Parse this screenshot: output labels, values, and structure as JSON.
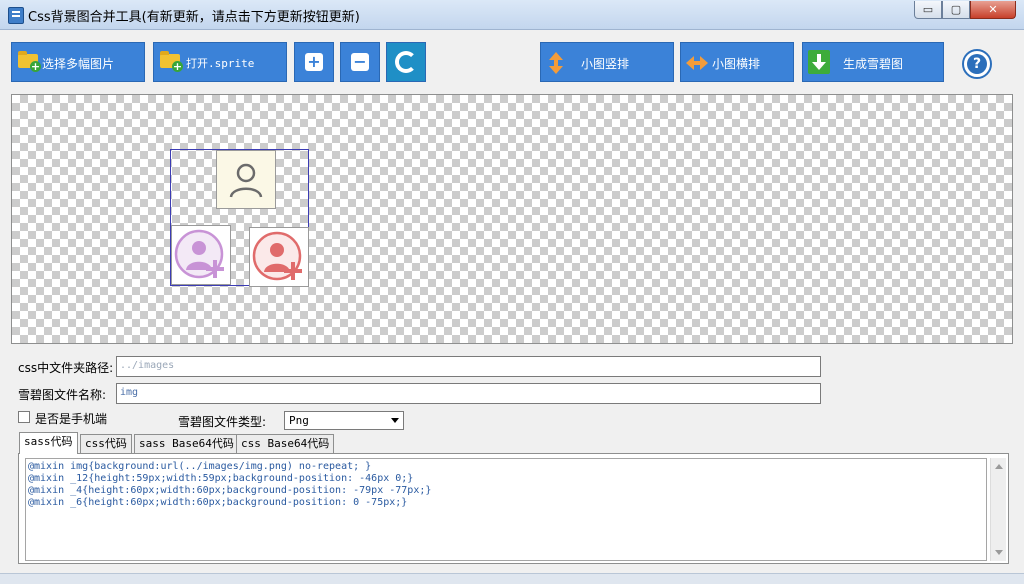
{
  "window": {
    "title": "Css背景图合并工具(有新更新，请点击下方更新按钮更新)",
    "controls": {
      "minimize": "▭",
      "maximize": "▢",
      "close": "✕"
    }
  },
  "toolbar": {
    "select_images": "选择多幅图片",
    "open_sprite": "打开.sprite",
    "add_icon": "+",
    "remove_icon": "−",
    "vertical": "小图竖排",
    "horizontal": "小图横排",
    "generate": "生成雪碧图",
    "help": "?",
    "accent": "#3b82d8"
  },
  "form": {
    "css_path_label": "css中文件夹路径:",
    "css_path_value": "../images",
    "sprite_name_label": "雪碧图文件名称:",
    "sprite_name_value": "img",
    "mobile_label": "是否是手机端",
    "filetype_label": "雪碧图文件类型:",
    "filetype_value": "Png"
  },
  "tabs": [
    "sass代码",
    "css代码",
    "sass Base64代码",
    "css Base64代码"
  ],
  "code_lines": [
    "@mixin img{background:url(../images/img.png) no-repeat; }",
    "@mixin _12{height:59px;width:59px;background-position: -46px 0;}",
    "@mixin _4{height:60px;width:60px;background-position: -79px -77px;}",
    "@mixin _6{height:60px;width:60px;background-position: 0 -75px;}"
  ],
  "icons": [
    "user-outline-icon",
    "user-add-purple-icon",
    "user-add-red-icon"
  ]
}
